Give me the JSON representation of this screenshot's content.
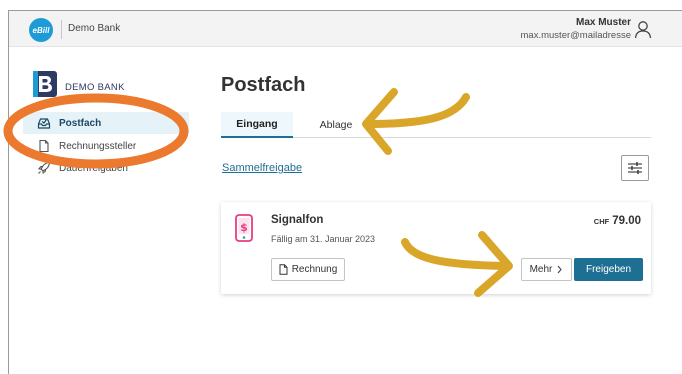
{
  "topbar": {
    "logo_text": "eBill",
    "bank_name": "Demo Bank",
    "user_name": "Max Muster",
    "user_email": "max.muster@mailadresse"
  },
  "sidebar": {
    "bank_name": "DEMO BANK",
    "items": [
      {
        "label": "Postfach",
        "icon": "inbox-icon",
        "active": true
      },
      {
        "label": "Rechnungssteller",
        "icon": "document-icon",
        "active": false
      },
      {
        "label": "Dauerfreigaben",
        "icon": "rocket-icon",
        "active": false
      }
    ]
  },
  "main": {
    "title": "Postfach",
    "tabs": [
      {
        "label": "Eingang",
        "active": true
      },
      {
        "label": "Ablage",
        "active": false
      }
    ],
    "bulk_approval_link": "Sammelfreigabe",
    "bill": {
      "biller": "Signalfon",
      "due_date": "Fällig am 31. Januar 2023",
      "currency": "CHF",
      "amount": "79.00",
      "invoice_button": "Rechnung",
      "more_button": "Mehr",
      "approve_button": "Freigeben"
    }
  },
  "colors": {
    "accent": "#1e6f94",
    "ebill_blue": "#1d9bd7",
    "annotation_orange": "#ec7a2e",
    "annotation_arrow": "#d9a62a",
    "biller_icon_pink": "#e83d84"
  }
}
